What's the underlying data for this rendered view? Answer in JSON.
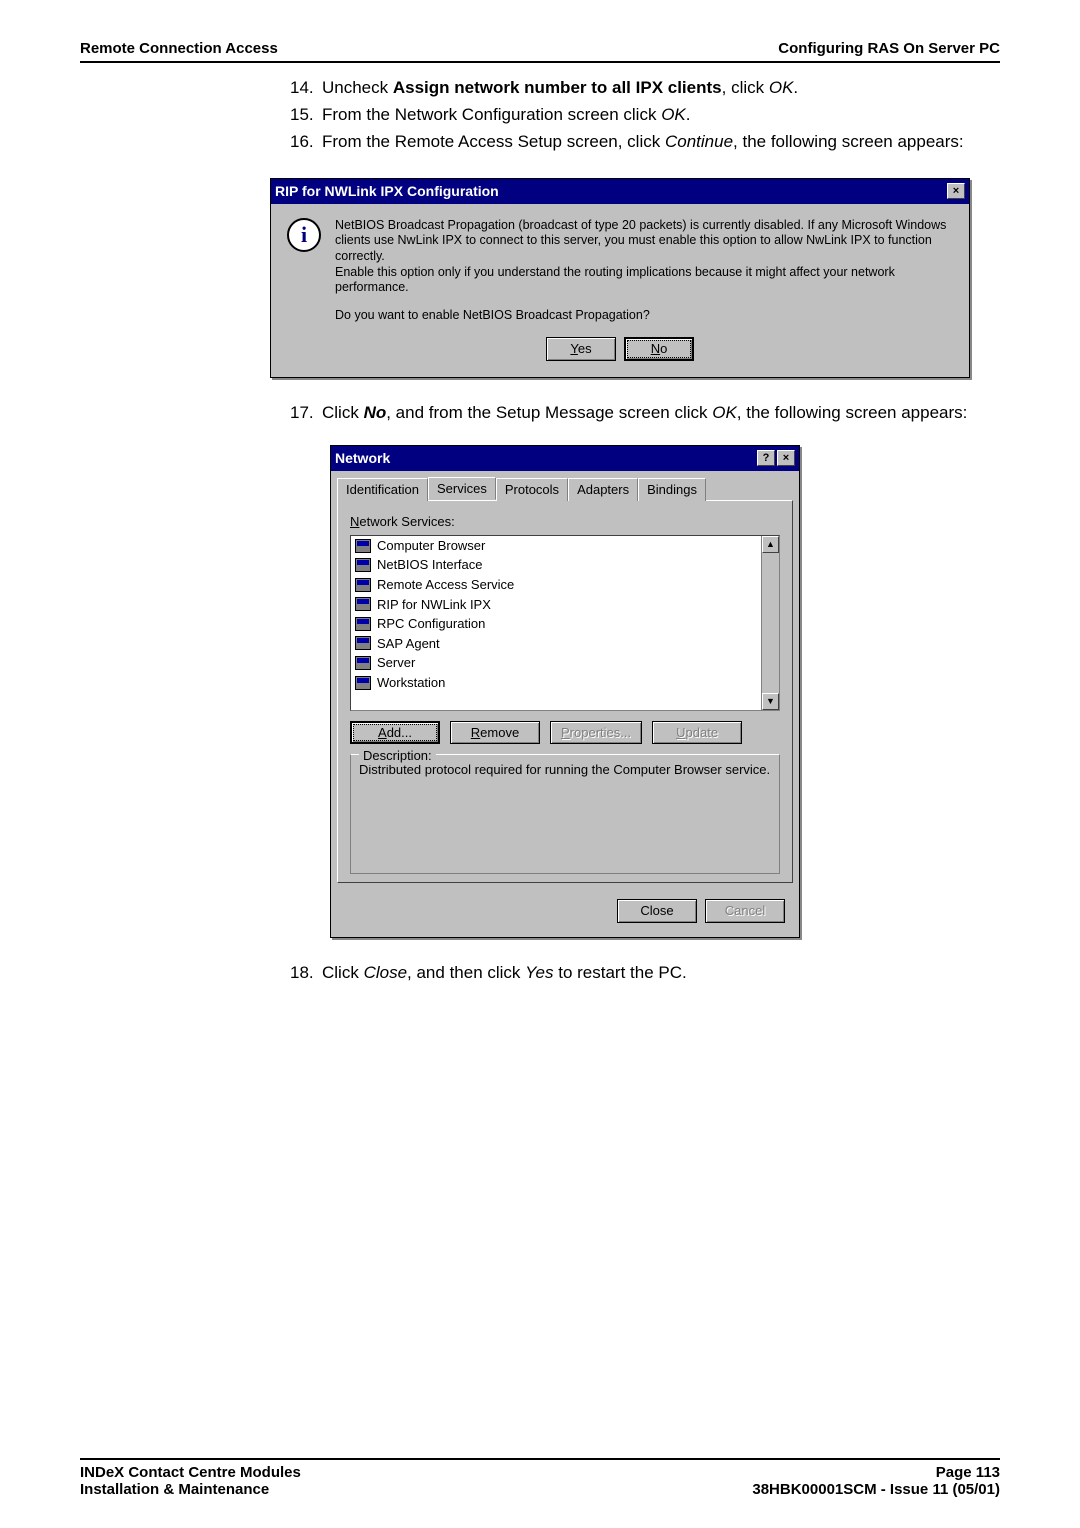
{
  "header": {
    "left": "Remote Connection Access",
    "right": "Configuring RAS On Server PC"
  },
  "steps": {
    "s14_num": "14.",
    "s14_a": "Uncheck ",
    "s14_b": "Assign network number to all IPX clients",
    "s14_c": ", click ",
    "s14_d": "OK",
    "s14_e": ".",
    "s15_num": "15.",
    "s15_a": "From the Network Configuration screen click ",
    "s15_b": "OK",
    "s15_c": ".",
    "s16_num": "16.",
    "s16_a": "From the Remote Access Setup screen, click ",
    "s16_b": "Continue",
    "s16_c": ", the following screen appears:",
    "s17_num": "17.",
    "s17_a": "Click ",
    "s17_b": "No",
    "s17_c": ", and from the Setup Message screen click ",
    "s17_d": "OK",
    "s17_e": ", the following screen appears:",
    "s18_num": "18.",
    "s18_a": "Click ",
    "s18_b": "Close",
    "s18_c": ", and then click ",
    "s18_d": "Yes",
    "s18_e": " to restart the PC."
  },
  "rip_dialog": {
    "title": "RIP for NWLink IPX Configuration",
    "close_glyph": "×",
    "info_glyph": "i",
    "body": "NetBIOS Broadcast Propagation (broadcast of type 20 packets) is currently disabled. If any Microsoft Windows clients use NwLink IPX to connect to this server, you must enable this option to allow NwLink IPX to function correctly.\nEnable this option only if you understand the routing implications because it might affect your network performance.",
    "prompt": "Do you want to enable NetBIOS Broadcast Propagation?",
    "yes_u": "Y",
    "yes_rest": "es",
    "no_u": "N",
    "no_rest": "o"
  },
  "net_dialog": {
    "title": "Network",
    "help_glyph": "?",
    "close_glyph": "×",
    "tabs": [
      "Identification",
      "Services",
      "Protocols",
      "Adapters",
      "Bindings"
    ],
    "ns_label_u": "N",
    "ns_label_rest": "etwork Services:",
    "services": [
      "Computer Browser",
      "NetBIOS Interface",
      "Remote Access Service",
      "RIP for NWLink IPX",
      "RPC Configuration",
      "SAP Agent",
      "Server",
      "Workstation"
    ],
    "scroll_up": "▲",
    "scroll_down": "▼",
    "btn_add_u": "A",
    "btn_add_rest": "dd...",
    "btn_remove_u": "R",
    "btn_remove_rest": "emove",
    "btn_props_u": "P",
    "btn_props_rest": "roperties...",
    "btn_update_u": "U",
    "btn_update_rest": "pdate",
    "desc_label": "Description:",
    "desc_text": "Distributed protocol required for running the Computer Browser service.",
    "close": "Close",
    "cancel": "Cancel"
  },
  "footer": {
    "l1": "INDeX Contact Centre Modules",
    "l2": "Installation & Maintenance",
    "r1": "Page 113",
    "r2": "38HBK00001SCM - Issue 11 (05/01)"
  }
}
